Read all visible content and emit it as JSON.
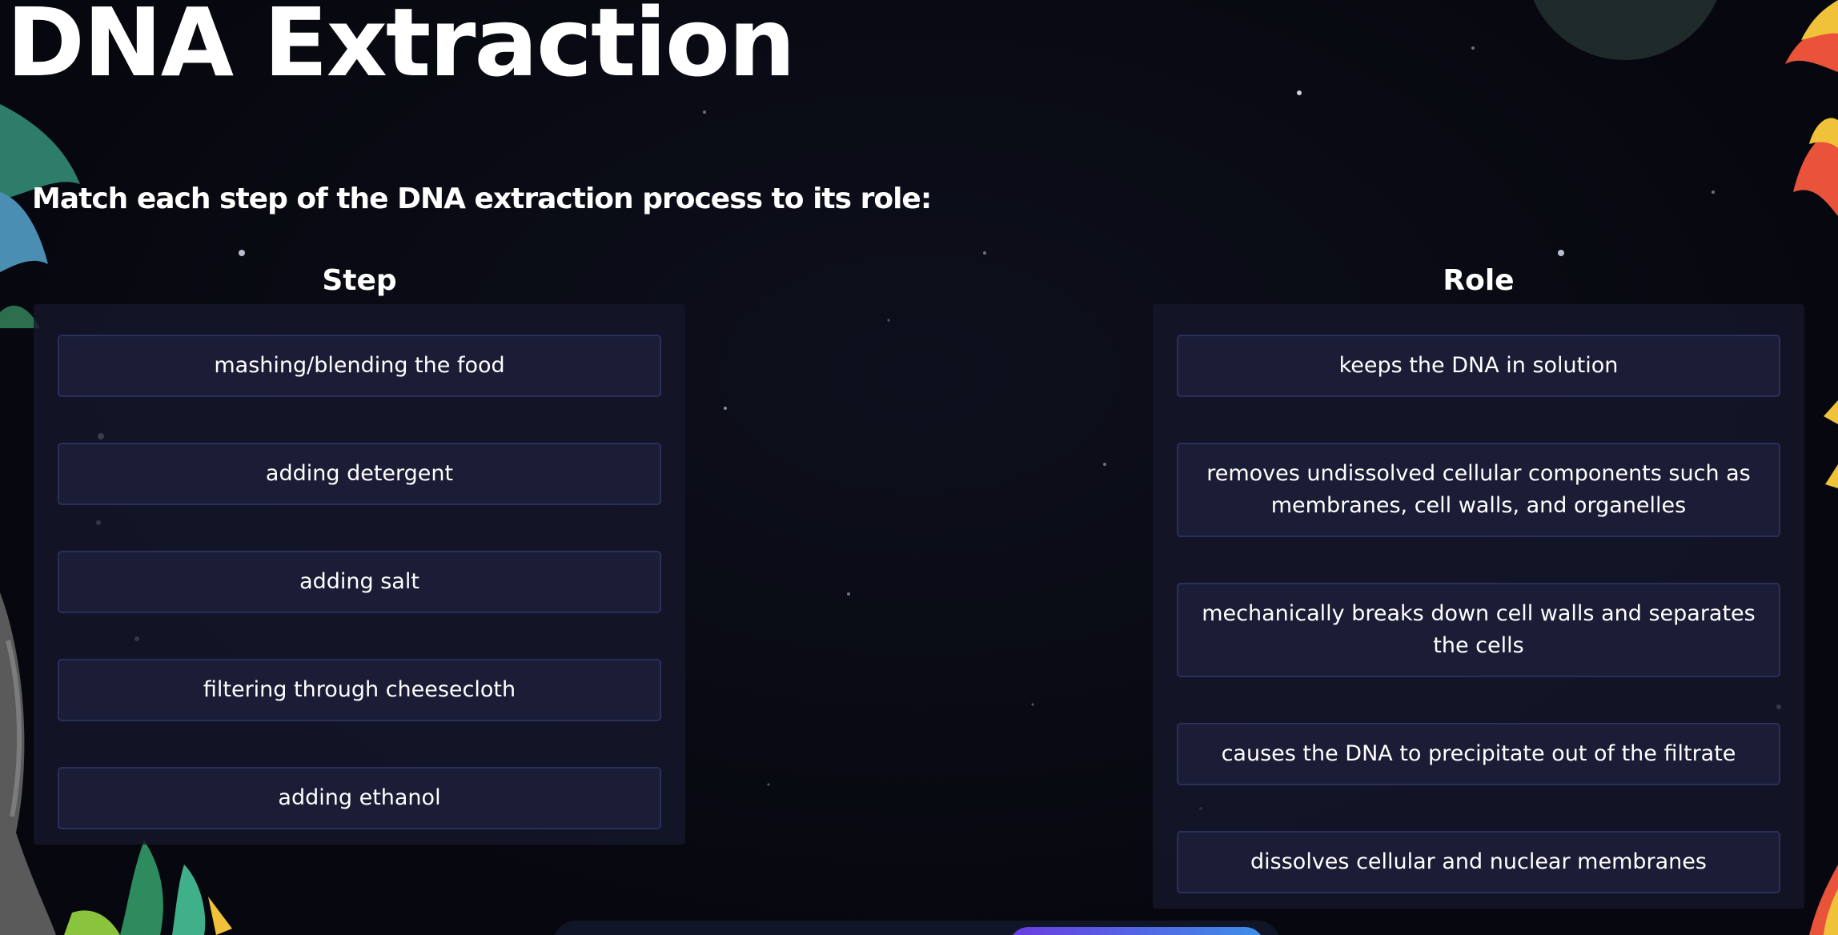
{
  "page": {
    "title": "DNA Extraction",
    "instruction": "Match each step of the DNA extraction process to its role:"
  },
  "steps": {
    "header": "Step",
    "items": [
      {
        "label": "mashing/blending the food"
      },
      {
        "label": "adding detergent"
      },
      {
        "label": "adding salt"
      },
      {
        "label": "filtering through cheesecloth"
      },
      {
        "label": "adding ethanol"
      }
    ]
  },
  "roles": {
    "header": "Role",
    "items": [
      {
        "label": "keeps the DNA in solution"
      },
      {
        "label": "removes undissolved cellular components such as membranes, cell walls, and organelles"
      },
      {
        "label": "mechanically breaks down cell walls and separates the cells"
      },
      {
        "label": "causes the DNA to precipitate out of the filtrate"
      },
      {
        "label": "dissolves cellular and nuclear membranes"
      }
    ]
  },
  "colors": {
    "background": "#07080f",
    "panel": "#16182c",
    "card_border": "#2c2f5a",
    "button_gradient_start": "#6a3ce0",
    "button_gradient_end": "#3e8fe8"
  }
}
